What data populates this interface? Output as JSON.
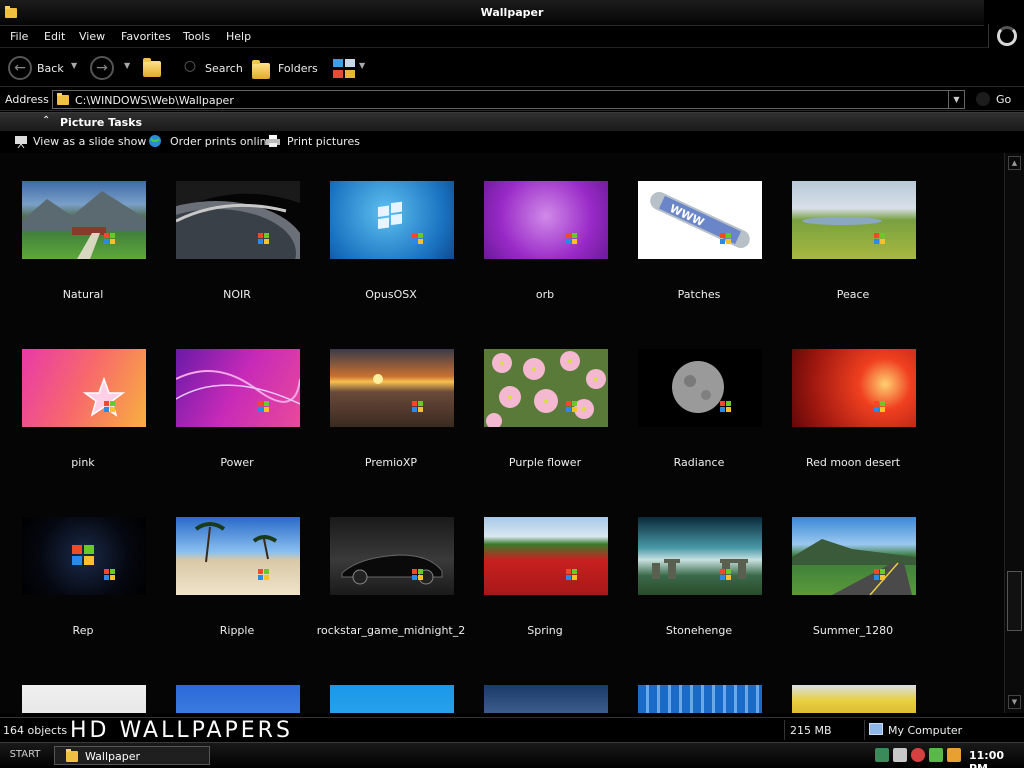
{
  "window": {
    "title": "Wallpaper"
  },
  "menu": [
    "File",
    "Edit",
    "View",
    "Favorites",
    "Tools",
    "Help"
  ],
  "toolbar": {
    "back_label": "Back",
    "search_label": "Search",
    "folders_label": "Folders"
  },
  "address": {
    "label": "Address",
    "value": "C:\\WINDOWS\\Web\\Wallpaper",
    "go_label": "Go"
  },
  "tasks": {
    "title": "Picture Tasks",
    "items": [
      "View as a slide show",
      "Order prints online",
      "Print pictures"
    ]
  },
  "files": [
    "Natural",
    "NOIR",
    "OpusOSX",
    "orb",
    "Patches",
    "Peace",
    "pink",
    "Power",
    "PremioXP",
    "Purple flower",
    "Radiance",
    "Red moon desert",
    "Rep",
    "Ripple",
    "rockstar_game_midnight_2",
    "Spring",
    "Stonehenge",
    "Summer_1280"
  ],
  "status": {
    "count": "164 objects",
    "watermark": "HD WALLPAPERS",
    "size": "215 MB",
    "location": "My Computer"
  },
  "taskbar": {
    "start_label": "START",
    "window_label": "Wallpaper",
    "clock": "11:00 PM"
  }
}
